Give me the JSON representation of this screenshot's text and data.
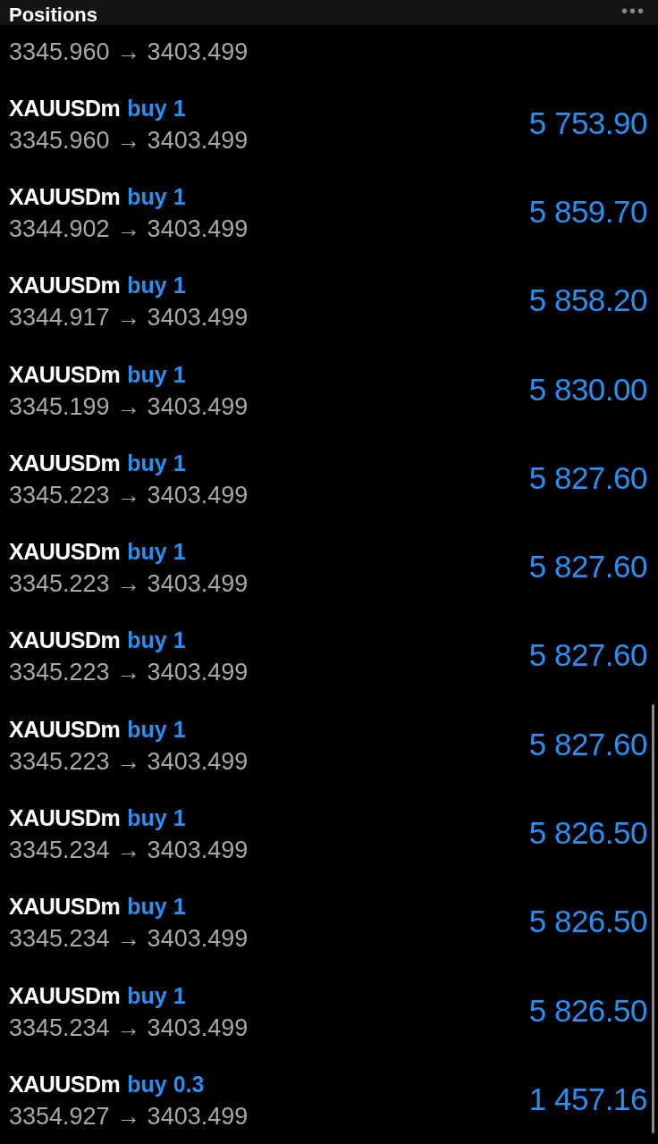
{
  "header": {
    "title": "Positions",
    "menu": "•••"
  },
  "partial_row": {
    "prices": "3345.960 → 3403.499"
  },
  "positions": [
    {
      "symbol": "XAUUSDm",
      "order": "buy 1",
      "prices": "3345.960 → 3403.499",
      "profit": "5 753.90"
    },
    {
      "symbol": "XAUUSDm",
      "order": "buy 1",
      "prices": "3344.902 → 3403.499",
      "profit": "5 859.70"
    },
    {
      "symbol": "XAUUSDm",
      "order": "buy 1",
      "prices": "3344.917 → 3403.499",
      "profit": "5 858.20"
    },
    {
      "symbol": "XAUUSDm",
      "order": "buy 1",
      "prices": "3345.199 → 3403.499",
      "profit": "5 830.00"
    },
    {
      "symbol": "XAUUSDm",
      "order": "buy 1",
      "prices": "3345.223 → 3403.499",
      "profit": "5 827.60"
    },
    {
      "symbol": "XAUUSDm",
      "order": "buy 1",
      "prices": "3345.223 → 3403.499",
      "profit": "5 827.60"
    },
    {
      "symbol": "XAUUSDm",
      "order": "buy 1",
      "prices": "3345.223 → 3403.499",
      "profit": "5 827.60"
    },
    {
      "symbol": "XAUUSDm",
      "order": "buy 1",
      "prices": "3345.223 → 3403.499",
      "profit": "5 827.60"
    },
    {
      "symbol": "XAUUSDm",
      "order": "buy 1",
      "prices": "3345.234 → 3403.499",
      "profit": "5 826.50"
    },
    {
      "symbol": "XAUUSDm",
      "order": "buy 1",
      "prices": "3345.234 → 3403.499",
      "profit": "5 826.50"
    },
    {
      "symbol": "XAUUSDm",
      "order": "buy 1",
      "prices": "3345.234 → 3403.499",
      "profit": "5 826.50"
    },
    {
      "symbol": "XAUUSDm",
      "order": "buy 0.3",
      "prices": "3354.927 → 3403.499",
      "profit": "1 457.16"
    }
  ]
}
